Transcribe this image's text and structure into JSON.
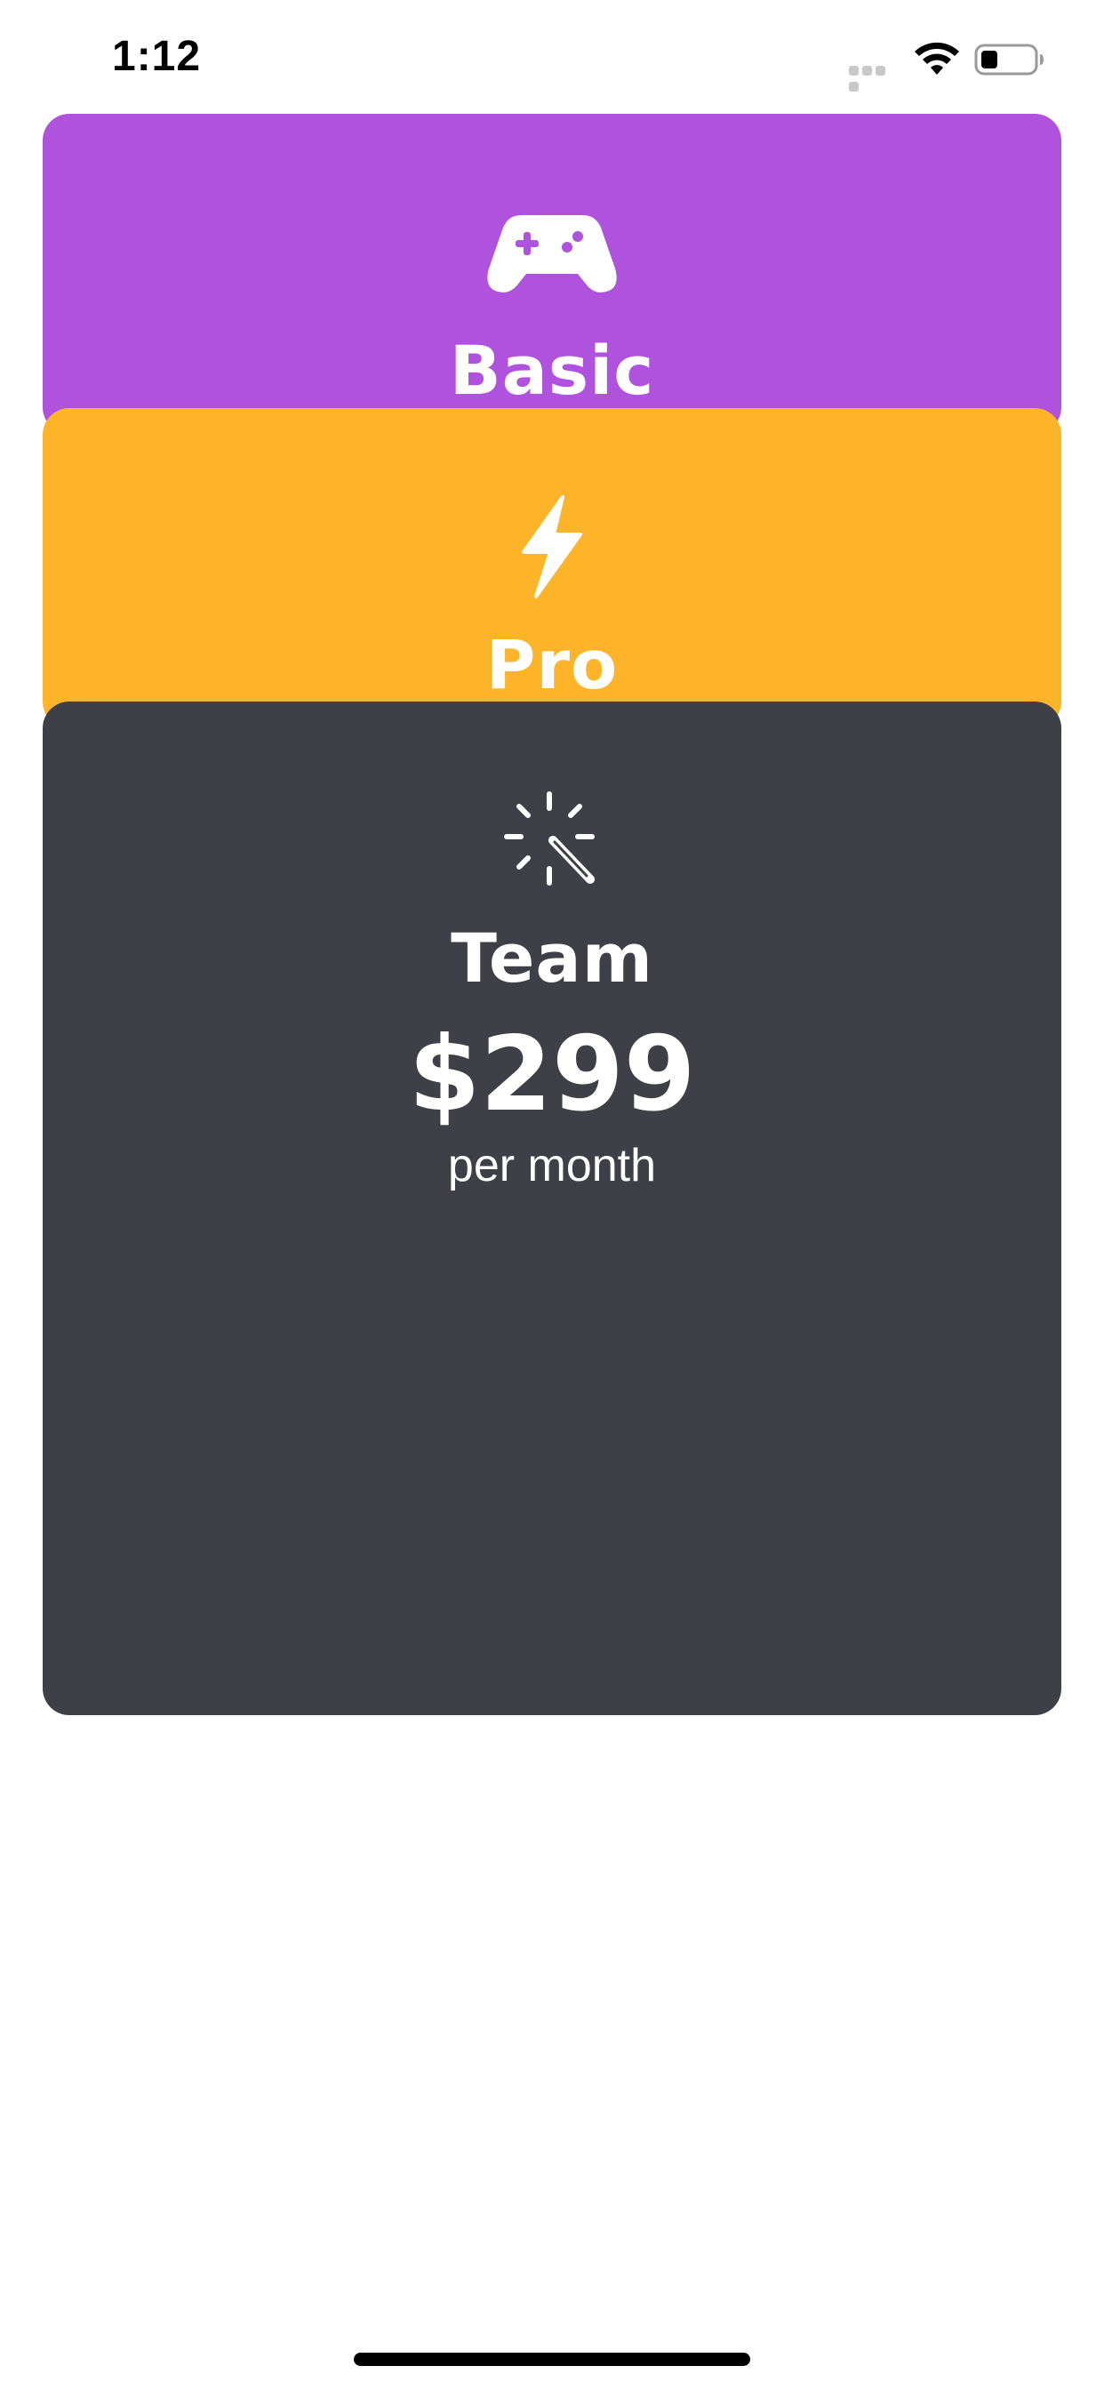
{
  "status_bar": {
    "time": "1:12"
  },
  "colors": {
    "basic": "#AF52DE",
    "pro": "#FEB429",
    "team": "#3F3F47"
  },
  "plans": [
    {
      "name": "Basic",
      "icon": "game-controller-icon"
    },
    {
      "name": "Pro",
      "icon": "lightning-bolt-icon"
    },
    {
      "name": "Team",
      "icon": "magic-wand-icon",
      "price": "$299",
      "period": "per month"
    }
  ]
}
